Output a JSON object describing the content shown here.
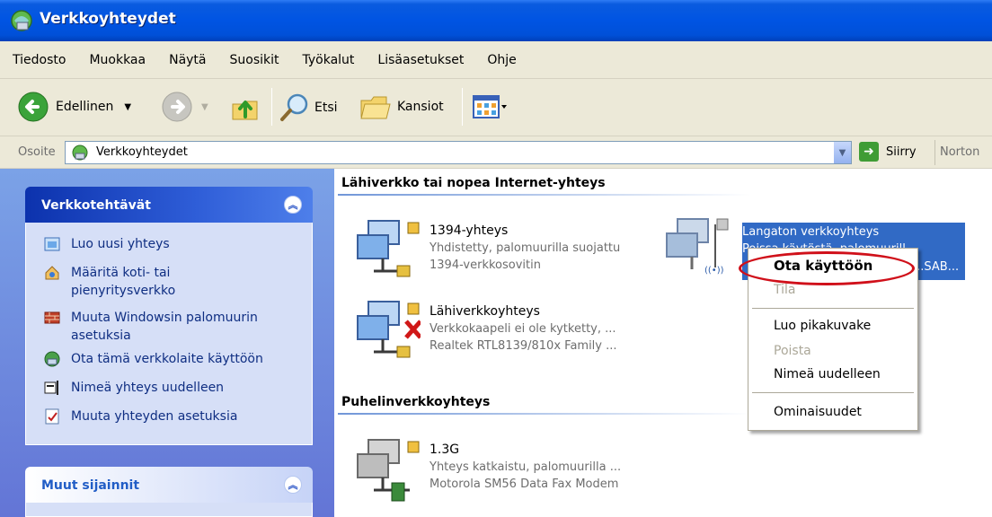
{
  "window": {
    "title": "Verkkoyhteydet"
  },
  "menu": [
    "Tiedosto",
    "Muokkaa",
    "Näytä",
    "Suosikit",
    "Työkalut",
    "Lisäasetukset",
    "Ohje"
  ],
  "toolbar": {
    "back_label": "Edellinen",
    "search_label": "Etsi",
    "folders_label": "Kansiot"
  },
  "address": {
    "label": "Osoite",
    "value": "Verkkoyhteydet",
    "go_label": "Siirry",
    "norton_label": "Norton"
  },
  "task_panels": {
    "network_tasks": {
      "title": "Verkkotehtävät",
      "items": [
        {
          "label": "Luo uusi yhteys",
          "icon": "new-connection-icon"
        },
        {
          "label": "Määritä koti- tai pienyritysverkko",
          "icon": "home-network-icon"
        },
        {
          "label": "Muuta Windowsin palomuurin asetuksia",
          "icon": "firewall-icon"
        },
        {
          "label": "Ota tämä verkkolaite käyttöön",
          "icon": "enable-device-icon"
        },
        {
          "label": "Nimeä yhteys uudelleen",
          "icon": "rename-icon"
        },
        {
          "label": "Muuta yhteyden asetuksia",
          "icon": "properties-icon"
        }
      ]
    },
    "other_places": {
      "title": "Muut sijainnit"
    }
  },
  "groups": [
    {
      "title": "Lähiverkko tai nopea Internet-yhteys",
      "connections": [
        {
          "name": "1394-yhteys",
          "status": "Yhdistetty, palomuurilla suojattu",
          "device": "1394-verkkosovitin"
        },
        {
          "name": "Lähiverkkoyhteys",
          "status": "Verkkokaapeli ei ole kytketty, ...",
          "device": "Realtek RTL8139/810x Family ..."
        },
        {
          "name": "Langaton verkkoyhteys",
          "status": "Poissa käytöstä, palomuurill...",
          "device": "...SAB..."
        }
      ]
    },
    {
      "title": "Puhelinverkkoyhteys",
      "connections": [
        {
          "name": "1.3G",
          "status": "Yhteys katkaistu, palomuurilla ...",
          "device": "Motorola SM56 Data Fax Modem"
        }
      ]
    }
  ],
  "context_menu": {
    "items": [
      {
        "label": "Ota käyttöön",
        "bold": true,
        "disabled": false
      },
      {
        "label": "Tila",
        "disabled": true
      },
      {
        "label": "Luo pikakuvake",
        "disabled": false
      },
      {
        "label": "Poista",
        "disabled": true
      },
      {
        "label": "Nimeä uudelleen",
        "disabled": false
      },
      {
        "label": "Ominaisuudet",
        "disabled": false
      }
    ]
  },
  "colors": {
    "titlebar": "#0054e3",
    "selection": "#316ac5",
    "highlight_ring": "#d0101a",
    "task_link": "#0f2e82"
  }
}
